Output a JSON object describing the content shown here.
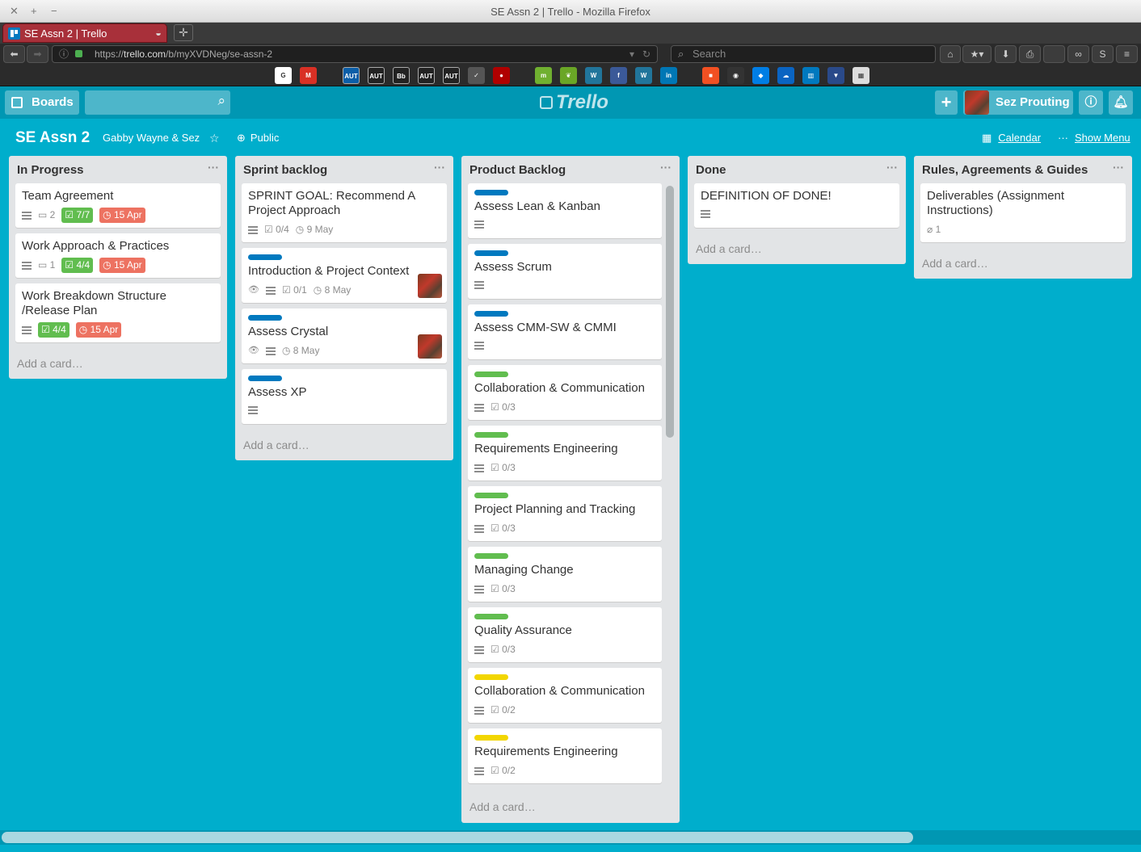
{
  "window": {
    "title": "SE Assn 2 | Trello - Mozilla Firefox"
  },
  "browser": {
    "tab_title": "SE Assn 2 | Trello",
    "url_scheme": "https://",
    "url_host": "trello.com",
    "url_path": "/b/myXVDNeg/se-assn-2",
    "search_placeholder": "Search"
  },
  "bookmarks": [
    {
      "name": "google-bookmark",
      "color": "#ffffff",
      "text": "G"
    },
    {
      "name": "gmail-bookmark",
      "color": "#d93025",
      "text": "M"
    },
    {
      "name": "aut-bookmark-1",
      "color": "#0b5ea8",
      "text": "AUT"
    },
    {
      "name": "aut-bookmark-2",
      "color": "#222222",
      "text": "AUT"
    },
    {
      "name": "blackboard-bookmark",
      "color": "#222222",
      "text": "Bb"
    },
    {
      "name": "aut-bookmark-3",
      "color": "#222222",
      "text": "AUT"
    },
    {
      "name": "aut-bookmark-4",
      "color": "#222222",
      "text": "AUT"
    },
    {
      "name": "pocket-bookmark",
      "color": "#555555",
      "text": "✓"
    },
    {
      "name": "dark-bookmark",
      "color": "#b00000",
      "text": "●"
    },
    {
      "name": "mint-bookmark",
      "color": "#70b030",
      "text": "m"
    },
    {
      "name": "leaf-bookmark",
      "color": "#6aa626",
      "text": "❦"
    },
    {
      "name": "wordpress-bookmark-1",
      "color": "#21759b",
      "text": "W"
    },
    {
      "name": "facebook-bookmark",
      "color": "#3b5998",
      "text": "f"
    },
    {
      "name": "wordpress-bookmark-2",
      "color": "#21759b",
      "text": "W"
    },
    {
      "name": "linkedin-bookmark",
      "color": "#0077b5",
      "text": "in"
    },
    {
      "name": "microsoft-bookmark",
      "color": "#f25022",
      "text": "■"
    },
    {
      "name": "github-bookmark",
      "color": "#333333",
      "text": "◉"
    },
    {
      "name": "dropbox-bookmark",
      "color": "#007ee5",
      "text": "◆"
    },
    {
      "name": "onedrive-bookmark",
      "color": "#0a64c2",
      "text": "☁"
    },
    {
      "name": "trello-bookmark",
      "color": "#0079bf",
      "text": "▥"
    },
    {
      "name": "shield-bookmark",
      "color": "#2a4a8a",
      "text": "▼"
    },
    {
      "name": "qr-bookmark",
      "color": "#dddddd",
      "text": "▦"
    }
  ],
  "header": {
    "boards_label": "Boards",
    "logo_text": "Trello",
    "user_name": "Sez Prouting"
  },
  "board": {
    "title": "SE Assn 2",
    "team": "Gabby Wayne & Sez",
    "visibility": "Public",
    "calendar_label": "Calendar",
    "show_menu_label": "Show Menu"
  },
  "add_card_label": "Add a card…",
  "lists": [
    {
      "title": "In Progress",
      "cards": [
        {
          "title": "Team Agreement",
          "desc": true,
          "comments": "2",
          "checklist": "7/7",
          "checklist_complete": true,
          "due": "15 Apr"
        },
        {
          "title": "Work Approach & Practices",
          "desc": true,
          "comments": "1",
          "checklist": "4/4",
          "checklist_complete": true,
          "due": "15 Apr"
        },
        {
          "title": "Work Breakdown Structure /Release Plan",
          "desc": true,
          "checklist": "4/4",
          "checklist_complete": true,
          "due": "15 Apr"
        }
      ]
    },
    {
      "title": "Sprint backlog",
      "cards": [
        {
          "title": "SPRINT GOAL: Recommend A Project Approach",
          "desc": true,
          "checklist": "0/4",
          "due": "9 May"
        },
        {
          "label": "#0079bf",
          "title": "Introduction & Project Context",
          "watch": true,
          "desc": true,
          "checklist": "0/1",
          "due": "8 May",
          "avatar": true
        },
        {
          "label": "#0079bf",
          "title": "Assess Crystal",
          "watch": true,
          "desc": true,
          "due": "8 May",
          "avatar": true
        },
        {
          "label": "#0079bf",
          "title": "Assess XP",
          "desc": true
        }
      ]
    },
    {
      "title": "Product Backlog",
      "cards": [
        {
          "label": "#0079bf",
          "title": "Assess Lean & Kanban",
          "desc": true
        },
        {
          "label": "#0079bf",
          "title": "Assess Scrum",
          "desc": true
        },
        {
          "label": "#0079bf",
          "title": "Assess CMM-SW & CMMI",
          "desc": true
        },
        {
          "label": "#61bd4f",
          "title": "Collaboration & Communication",
          "desc": true,
          "checklist": "0/3"
        },
        {
          "label": "#61bd4f",
          "title": "Requirements Engineering",
          "desc": true,
          "checklist": "0/3"
        },
        {
          "label": "#61bd4f",
          "title": "Project Planning and Tracking",
          "desc": true,
          "checklist": "0/3"
        },
        {
          "label": "#61bd4f",
          "title": "Managing Change",
          "desc": true,
          "checklist": "0/3"
        },
        {
          "label": "#61bd4f",
          "title": "Quality Assurance",
          "desc": true,
          "checklist": "0/3"
        },
        {
          "label": "#f2d600",
          "title": "Collaboration & Communication",
          "desc": true,
          "checklist": "0/2"
        },
        {
          "label": "#f2d600",
          "title": "Requirements Engineering",
          "desc": true,
          "checklist": "0/2"
        }
      ]
    },
    {
      "title": "Done",
      "cards": [
        {
          "title": "DEFINITION OF DONE!",
          "desc": true
        }
      ]
    },
    {
      "title": "Rules, Agreements & Guides",
      "cards": [
        {
          "title": "Deliverables (Assignment Instructions)",
          "attachments": "1"
        }
      ]
    }
  ]
}
